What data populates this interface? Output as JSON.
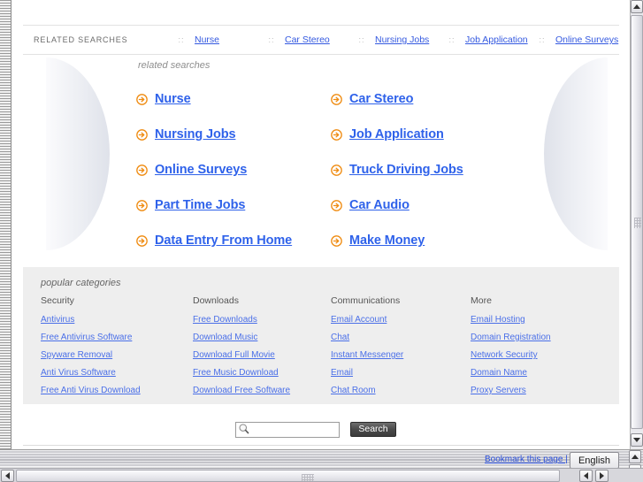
{
  "top_strip": {
    "label": "RELATED SEARCHES",
    "separator": "::",
    "links": [
      "Nurse",
      "Car Stereo",
      "Nursing Jobs",
      "Job Application",
      "Online Surveys"
    ]
  },
  "main": {
    "title": "related searches",
    "icon_name": "orange-arrow-icon",
    "links": [
      "Nurse",
      "Car Stereo",
      "Nursing Jobs",
      "Job Application",
      "Online Surveys",
      "Truck Driving Jobs",
      "Part Time Jobs",
      "Car Audio",
      "Data Entry From Home",
      "Make Money"
    ]
  },
  "categories": {
    "title": "popular categories",
    "columns": [
      {
        "heading": "Security",
        "links": [
          "Antivirus",
          "Free Antivirus Software",
          "Spyware Removal",
          "Anti Virus Software",
          "Free Anti Virus Download"
        ]
      },
      {
        "heading": "Downloads",
        "links": [
          "Free Downloads",
          "Download Music",
          "Download Full Movie",
          "Free Music Download",
          "Download Free Software"
        ]
      },
      {
        "heading": "Communications",
        "links": [
          "Email Account",
          "Chat",
          "Instant Messenger",
          "Email",
          "Chat Room"
        ]
      },
      {
        "heading": "More",
        "links": [
          "Email Hosting",
          "Domain Registration",
          "Network Security",
          "Domain Name",
          "Proxy Servers"
        ]
      }
    ]
  },
  "search": {
    "value": "",
    "placeholder": "",
    "button_label": "Search",
    "icon_name": "magnifier-icon"
  },
  "statusbar": {
    "bookmark_label": "Bookmark this page |",
    "language_value": "English"
  },
  "colors": {
    "link_blue": "#3459e0",
    "main_link_blue": "#2f62ea",
    "arrow_orange": "#ef8b10",
    "panel_gray": "#eeeeee"
  }
}
